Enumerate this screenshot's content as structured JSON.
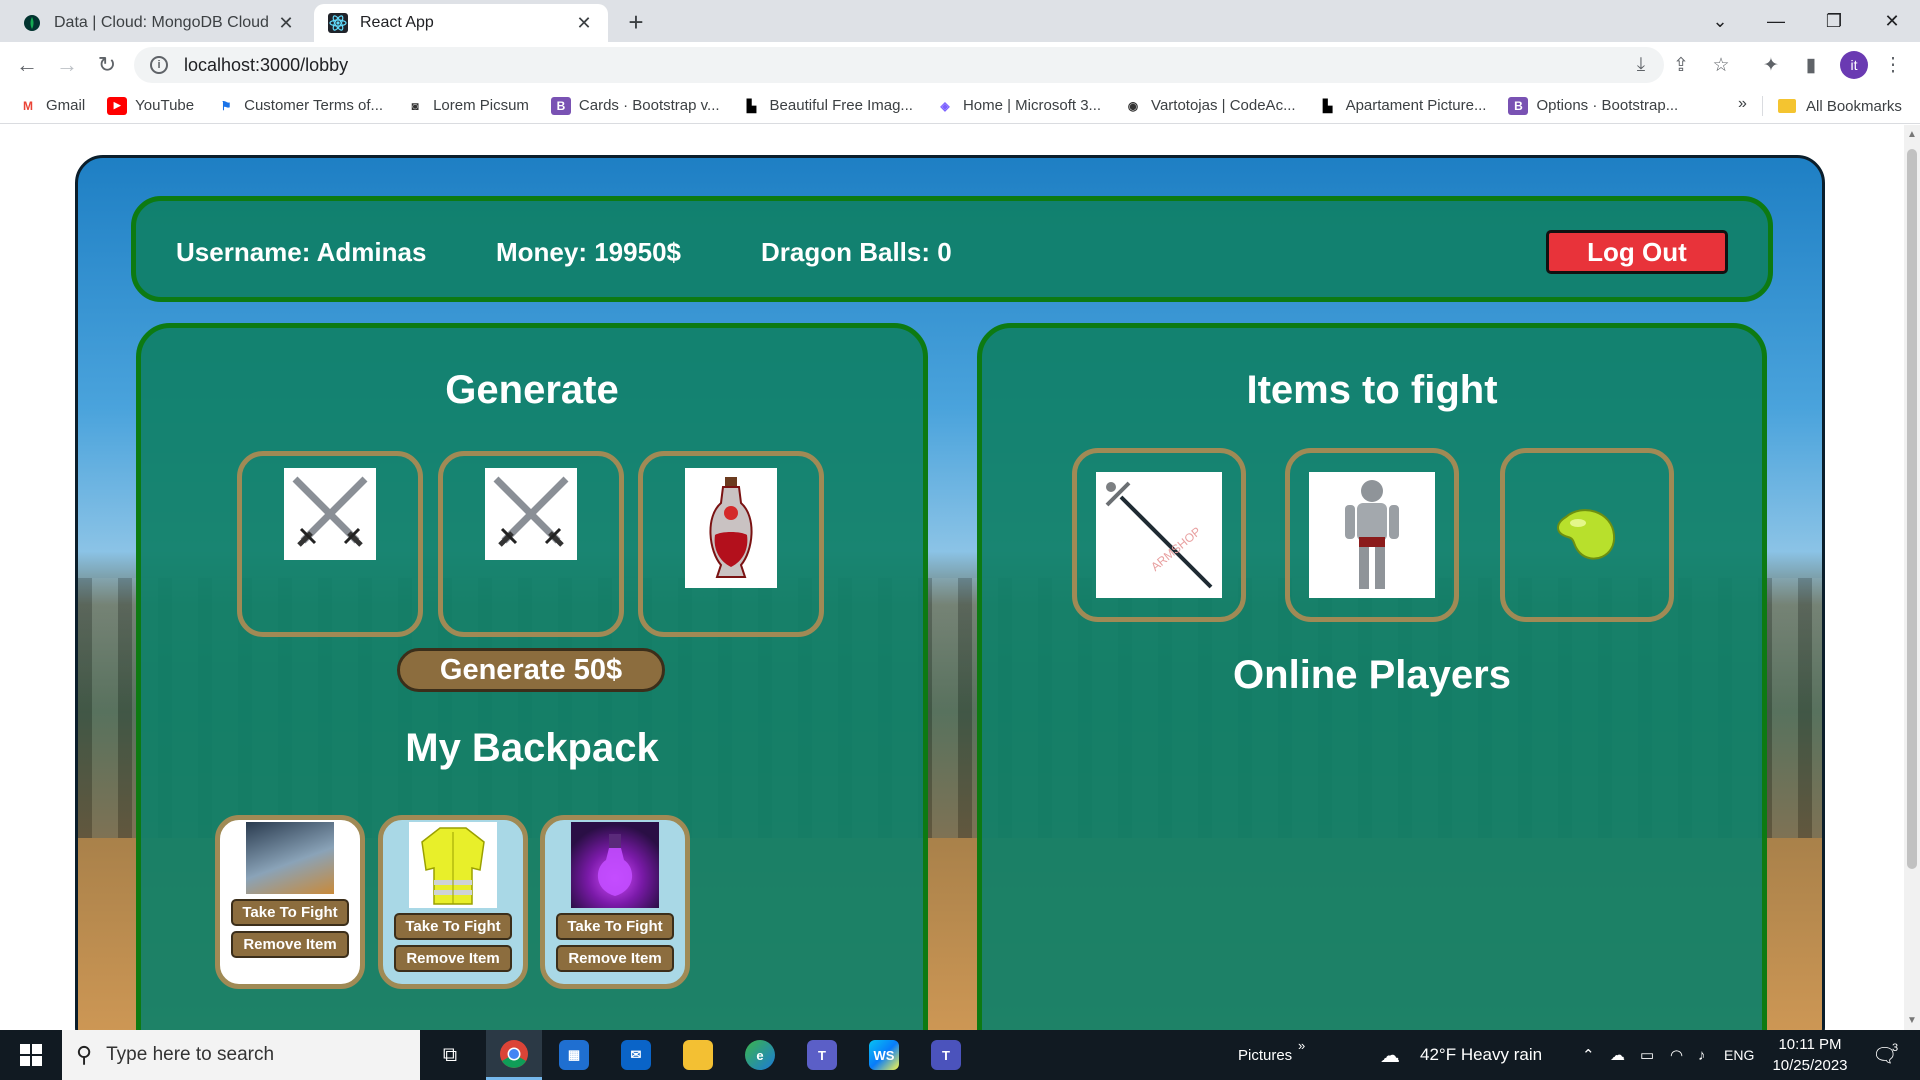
{
  "browser": {
    "tabs": [
      {
        "title": "Data | Cloud: MongoDB Cloud",
        "icon": "mongodb-leaf-icon"
      },
      {
        "title": "React App",
        "icon": "react-icon"
      }
    ],
    "url": "localhost:3000/lobby",
    "profile_initial": "it",
    "bookmarks": [
      {
        "label": "Gmail",
        "icon": "gmail-icon"
      },
      {
        "label": "YouTube",
        "icon": "youtube-icon"
      },
      {
        "label": "Customer Terms of...",
        "icon": "flag-icon"
      },
      {
        "label": "Lorem Picsum",
        "icon": "camera-icon"
      },
      {
        "label": "Cards · Bootstrap v...",
        "icon": "bootstrap-icon"
      },
      {
        "label": "Beautiful Free Imag...",
        "icon": "unsplash-icon"
      },
      {
        "label": "Home | Microsoft 3...",
        "icon": "microsoft365-icon"
      },
      {
        "label": "Vartotojas | CodeAc...",
        "icon": "codeacademy-icon"
      },
      {
        "label": "Apartament Picture...",
        "icon": "unsplash-icon"
      },
      {
        "label": "Options · Bootstrap...",
        "icon": "bootstrap-icon"
      }
    ],
    "bookmarks_more": "»",
    "all_bookmarks": "All Bookmarks"
  },
  "header": {
    "username": "Username: Adminas",
    "money": "Money: 19950$",
    "dragon_balls": "Dragon Balls: 0",
    "logout_label": "Log Out"
  },
  "generate": {
    "title": "Generate",
    "items": [
      "crossed-swords-icon",
      "crossed-swords-icon",
      "potion-vial-icon"
    ],
    "button_label": "Generate 50$"
  },
  "backpack": {
    "title": "My Backpack",
    "items": [
      {
        "image": "flying-hero-image",
        "take_label": "Take To Fight",
        "remove_label": "Remove Item",
        "card_color": "#ffffff"
      },
      {
        "image": "yellow-jacket-image",
        "take_label": "Take To Fight",
        "remove_label": "Remove Item",
        "card_color": "#a9d8e6"
      },
      {
        "image": "purple-potion-image",
        "take_label": "Take To Fight",
        "remove_label": "Remove Item",
        "card_color": "#a9d8e6"
      }
    ]
  },
  "fight": {
    "title": "Items to fight",
    "items": [
      "sword-image",
      "knight-armor-image",
      "green-bean-image"
    ]
  },
  "online": {
    "title": "Online Players"
  },
  "taskbar": {
    "search_placeholder": "Type here to search",
    "pictures_label": "Pictures",
    "weather": "42°F  Heavy rain",
    "language": "ENG",
    "time": "10:11 PM",
    "date": "10/25/2023",
    "notification_count": "3"
  },
  "colors": {
    "panel_green": "#108068",
    "border_green": "#0d7a12",
    "logout_red": "#e8333a",
    "button_brown": "#8c6d3e",
    "slot_border": "#a08a55"
  }
}
